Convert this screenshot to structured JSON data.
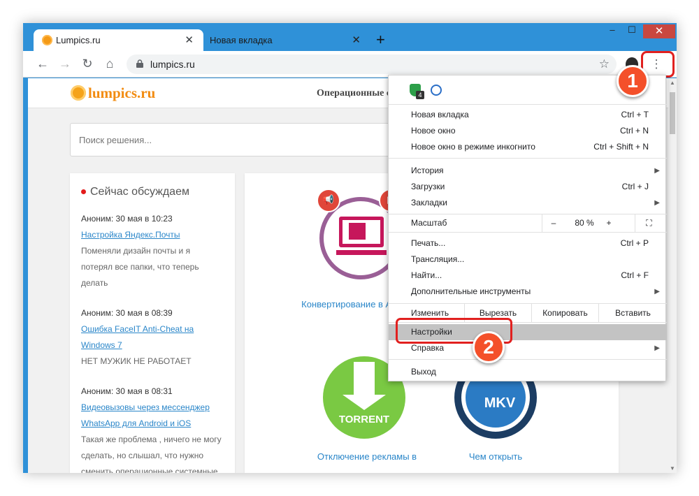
{
  "tabs": [
    {
      "title": "Lumpics.ru",
      "close": "✕"
    },
    {
      "title": "Новая вкладка",
      "close": "✕"
    }
  ],
  "new_tab": "+",
  "window_controls": {
    "minimize": "–",
    "maximize": "☐",
    "close": "✕"
  },
  "toolbar": {
    "back": "←",
    "forward": "→",
    "reload": "↻",
    "home": "⌂",
    "url": "lumpics.ru",
    "star": "☆",
    "menu": "⋮"
  },
  "site": {
    "logo": "lumpics.ru",
    "nav": "Операционные с",
    "search_placeholder": "Поиск решения...",
    "discussion_title": "Сейчас обсуждаем",
    "discussions": [
      {
        "meta": "Аноним: 30 мая в 10:23",
        "link": "Настройка Яндекс.Почты",
        "excerpt": "Поменяли дизайн почты и я потерял все папки, что теперь делать"
      },
      {
        "meta": "Аноним: 30 мая в 08:39",
        "link": "Ошибка FaceIT Anti-Cheat на Windows 7",
        "excerpt": "НЕТ МУЖИК НЕ РАБОТАЕТ"
      },
      {
        "meta": "Аноним: 30 мая в 08:31",
        "link": "Видеовызовы через мессенджер WhatsApp для Android и iOS",
        "excerpt": "Такая же проблема , ничего не могу сделать, но слышал, что нужно сменить операционные системные"
      }
    ],
    "cards": [
      {
        "title": "Конвертирование в AVI онлайн"
      },
      {
        "title": "Отключение рекламы в",
        "image_text": "TORRENT"
      },
      {
        "title": "Чем открыть",
        "image_text": "MKV"
      }
    ]
  },
  "menu": {
    "items": [
      {
        "label": "Новая вкладка",
        "shortcut": "Ctrl + T"
      },
      {
        "label": "Новое окно",
        "shortcut": "Ctrl + N"
      },
      {
        "label": "Новое окно в режиме инкогнито",
        "shortcut": "Ctrl + Shift + N"
      },
      {
        "label": "История",
        "shortcut": ""
      },
      {
        "label": "Загрузки",
        "shortcut": "Ctrl + J"
      },
      {
        "label": "Закладки",
        "shortcut": ""
      },
      {
        "label": "Печать...",
        "shortcut": "Ctrl + P"
      },
      {
        "label": "Трансляция...",
        "shortcut": ""
      },
      {
        "label": "Найти...",
        "shortcut": "Ctrl + F"
      },
      {
        "label": "Дополнительные инструменты",
        "shortcut": ""
      },
      {
        "label": "Настройки",
        "shortcut": ""
      },
      {
        "label": "Справка",
        "shortcut": ""
      },
      {
        "label": "Выход",
        "shortcut": ""
      }
    ],
    "zoom": {
      "label": "Масштаб",
      "minus": "–",
      "value": "80 %",
      "plus": "+",
      "fullscreen": "⛶"
    },
    "edit": {
      "label": "Изменить",
      "cut": "Вырезать",
      "copy": "Копировать",
      "paste": "Вставить"
    },
    "ext_badge": "4"
  },
  "annotations": {
    "step1": "1",
    "step2": "2"
  },
  "colors": {
    "chrome_blue": "#2f91d8",
    "highlight_red": "#e1201f",
    "step_orange": "#f4502a",
    "link_blue": "#2a86c9"
  }
}
